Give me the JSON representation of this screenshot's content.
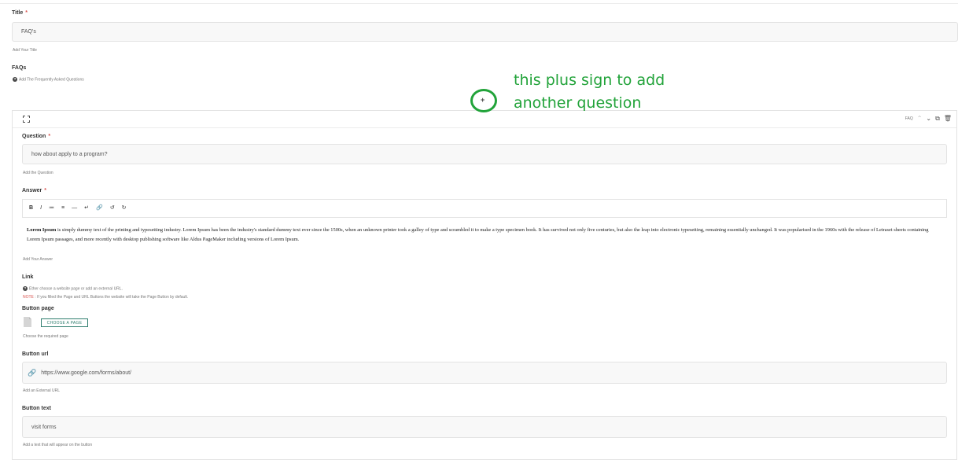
{
  "title_field": {
    "label": "Title",
    "required_mark": "*",
    "value": "FAQ's",
    "help": "Add Your Title"
  },
  "faqs": {
    "label": "FAQs",
    "help": "Add The Frequently Asked Questions"
  },
  "annotation": {
    "text": "this plus sign to add another question",
    "color": "#22a33a"
  },
  "faq_item": {
    "type_label": "FAQ",
    "question": {
      "label": "Question",
      "required_mark": "*",
      "value": "how about apply to a program?",
      "help": "Add the Question"
    },
    "answer": {
      "label": "Answer",
      "required_mark": "*",
      "toolbar": [
        "B",
        "I",
        "≔",
        "≡",
        "—",
        "↵",
        "🔗",
        "↺",
        "↻"
      ],
      "lead": "Lorem Ipsum",
      "body": " is simply dummy text of the printing and typesetting industry. Lorem Ipsum has been the industry's standard dummy text ever since the 1500s, when an unknown printer took a galley of type and scrambled it to make a type specimen book. It has survived not only five centuries, but also the leap into electronic typesetting, remaining essentially unchanged. It was popularised in the 1960s with the release of Letraset sheets containing Lorem Ipsum passages, and more recently with desktop publishing software like Aldus PageMaker including versions of Lorem Ipsum.",
      "help": "Add Your Answer"
    },
    "link": {
      "label": "Link",
      "help": "Ether choose a website page or add an external URL.",
      "note_label": "NOTE",
      "note_text": " : If you filled the Page and URL Buttons the website will take the Page Button by default."
    },
    "button_page": {
      "label": "Button page",
      "button": "CHOOSE A PAGE",
      "help": "Choose the required page"
    },
    "button_url": {
      "label": "Button url",
      "value": "https://www.google.com/forms/about/",
      "help": "Add an External URL"
    },
    "button_text": {
      "label": "Button text",
      "value": "visit forms",
      "help": "Add a text that will appear on the button"
    }
  }
}
